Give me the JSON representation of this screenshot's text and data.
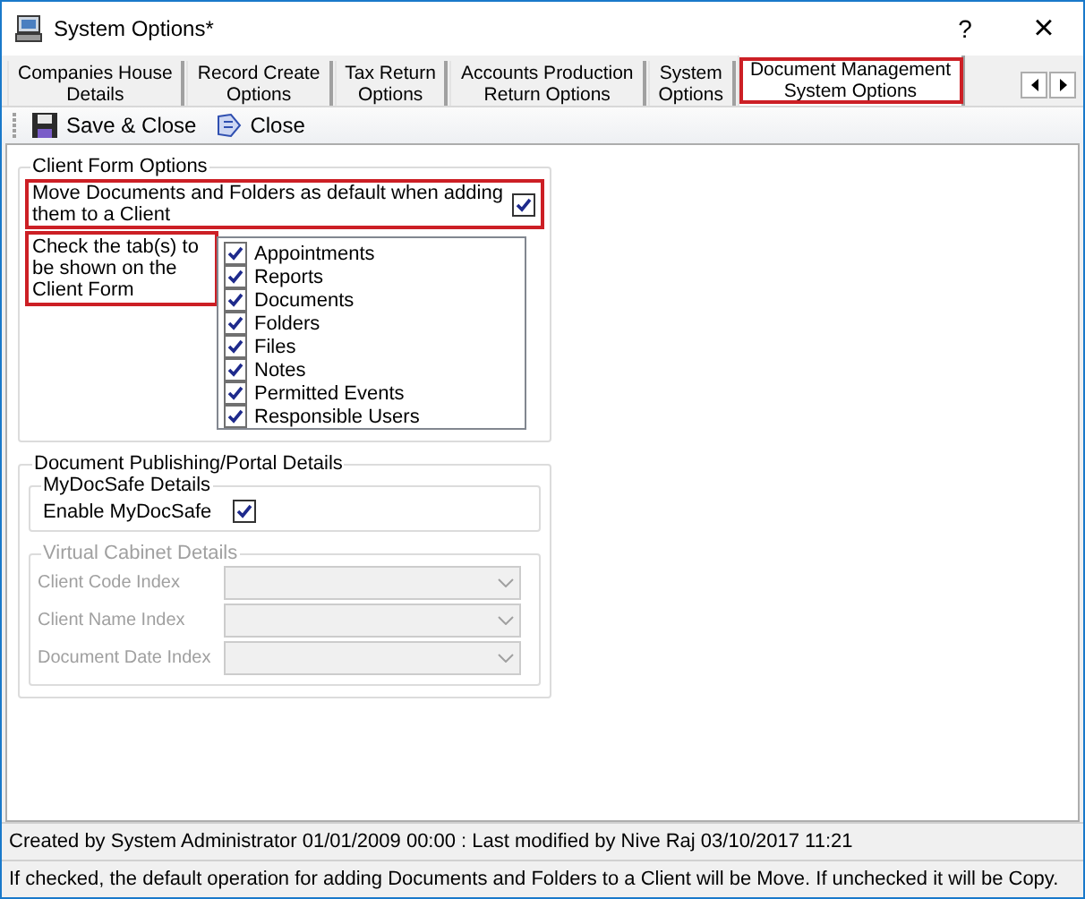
{
  "window": {
    "title": "System Options*",
    "help": "?",
    "close": "×"
  },
  "tabs": [
    {
      "label": "Companies House\nDetails",
      "selected": false,
      "highlighted": false
    },
    {
      "label": "Record Create\nOptions",
      "selected": false,
      "highlighted": false
    },
    {
      "label": "Tax Return\nOptions",
      "selected": false,
      "highlighted": false
    },
    {
      "label": "Accounts Production\nReturn Options",
      "selected": false,
      "highlighted": false
    },
    {
      "label": "System\nOptions",
      "selected": false,
      "highlighted": false
    },
    {
      "label": "Document Management\nSystem Options",
      "selected": true,
      "highlighted": true
    }
  ],
  "toolbar": [
    {
      "kind": "save",
      "label": "Save & Close"
    },
    {
      "kind": "close",
      "label": "Close"
    }
  ],
  "client_form_options": {
    "title": "Client Form Options",
    "move_default": {
      "label": "Move Documents and Folders as default when adding them to a Client",
      "checked": true,
      "highlighted": true
    },
    "client_tabs": {
      "label": "Check the tab(s) to be shown on the Client Form",
      "highlighted": true,
      "items": [
        {
          "label": "Appointments",
          "checked": true
        },
        {
          "label": "Reports",
          "checked": true
        },
        {
          "label": "Documents",
          "checked": true
        },
        {
          "label": "Folders",
          "checked": true
        },
        {
          "label": "Files",
          "checked": true
        },
        {
          "label": "Notes",
          "checked": true
        },
        {
          "label": "Permitted Events",
          "checked": true
        },
        {
          "label": "Responsible Users",
          "checked": true
        }
      ]
    }
  },
  "publishing": {
    "title": "Document Publishing/Portal Details",
    "mydocsafe": {
      "title": "MyDocSafe Details",
      "enable": {
        "label": "Enable MyDocSafe",
        "checked": true
      }
    },
    "virtual_cabinet": {
      "title": "Virtual Cabinet Details",
      "disabled": true,
      "fields": [
        {
          "label": "Client Code Index"
        },
        {
          "label": "Client Name Index"
        },
        {
          "label": "Document Date Index"
        }
      ]
    }
  },
  "status_bar": [
    "Created by System Administrator 01/01/2009 00:00 : Last modified by Nive Raj 03/10/2017 11:21",
    "If checked, the default operation for adding Documents and Folders to a Client will be Move. If unchecked it will be Copy."
  ]
}
